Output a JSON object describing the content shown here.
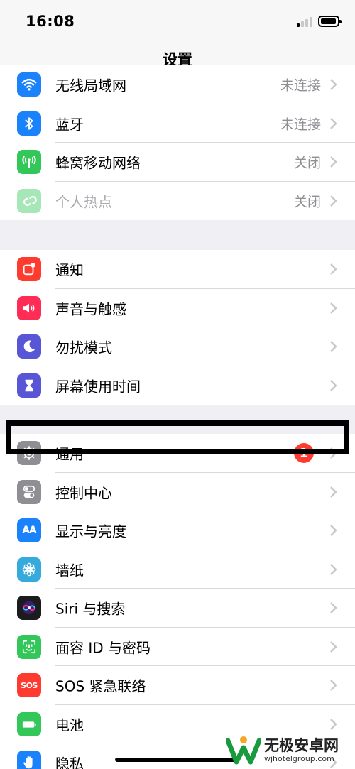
{
  "status_bar": {
    "time": "16:08"
  },
  "nav": {
    "title": "设置"
  },
  "colors": {
    "wifi": "#1a82fb",
    "bluetooth": "#1a82fb",
    "cellular": "#33c759",
    "hotspot": "#a7e6b6",
    "notifications": "#ff3b30",
    "sounds": "#ff2d55",
    "dnd": "#5856d6",
    "screen_time": "#5856d6",
    "general": "#8e8e93",
    "control_center": "#8e8e93",
    "display": "#1a82fb",
    "wallpaper": "#35aadc",
    "siri": "#1c1c1e",
    "face_id": "#33c759",
    "sos": "#ff3b30",
    "battery": "#33c759",
    "privacy": "#1a82fb",
    "badge": "#ff3b30"
  },
  "group1": [
    {
      "label": "无线局域网",
      "detail": "未连接",
      "icon": "wifi-icon"
    },
    {
      "label": "蓝牙",
      "detail": "未连接",
      "icon": "bluetooth-icon"
    },
    {
      "label": "蜂窝移动网络",
      "detail": "关闭",
      "icon": "cellular-icon"
    },
    {
      "label": "个人热点",
      "detail": "关闭",
      "icon": "hotspot-icon"
    }
  ],
  "group2": [
    {
      "label": "通知",
      "icon": "notifications-icon"
    },
    {
      "label": "声音与触感",
      "icon": "speaker-icon"
    },
    {
      "label": "勿扰模式",
      "icon": "moon-icon"
    },
    {
      "label": "屏幕使用时间",
      "icon": "hourglass-icon"
    }
  ],
  "group3": [
    {
      "label": "通用",
      "badge": "1",
      "icon": "gear-icon"
    },
    {
      "label": "控制中心",
      "icon": "toggles-icon"
    },
    {
      "label": "显示与亮度",
      "icon": "text-size-icon",
      "icon_text": "AA"
    },
    {
      "label": "墙纸",
      "icon": "flower-icon"
    },
    {
      "label": "Siri 与搜索",
      "icon": "siri-icon"
    },
    {
      "label": "面容 ID 与密码",
      "icon": "face-id-icon"
    },
    {
      "label": "SOS 紧急联络",
      "icon": "sos-icon",
      "icon_text": "SOS"
    },
    {
      "label": "电池",
      "icon": "battery-icon"
    },
    {
      "label": "隐私",
      "icon": "hand-icon"
    }
  ],
  "watermark": {
    "name": "无极安卓网",
    "url": "wjhotelgroup.com"
  }
}
